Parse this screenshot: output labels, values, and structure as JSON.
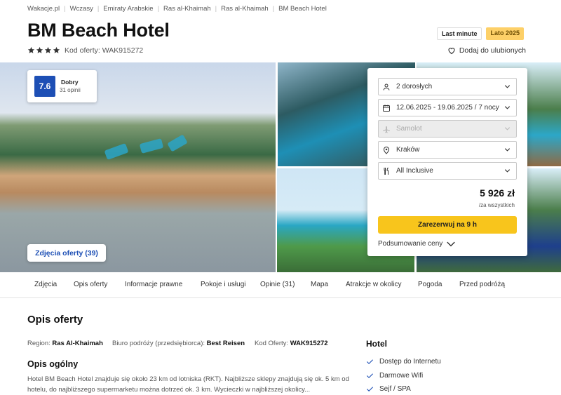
{
  "breadcrumbs": [
    "Wakacje.pl",
    "Wczasy",
    "Emiraty Arabskie",
    "Ras al-Khaimah",
    "Ras al-Khaimah",
    "BM Beach Hotel"
  ],
  "hotel": {
    "name": "BM Beach Hotel",
    "stars": 4,
    "offer_code_label": "Kod oferty: WAK915272"
  },
  "badges": {
    "last_minute": "Last minute",
    "season": "Lato 2025"
  },
  "favorite_label": "Dodaj do ulubionych",
  "rating": {
    "score": "7.6",
    "label": "Dobry",
    "count": "31 opinii"
  },
  "photos_button": "Zdjęcia oferty (39)",
  "booking": {
    "travelers": "2 dorosłych",
    "dates": "12.06.2025 - 19.06.2025 / 7 nocy",
    "transport": "Samolot",
    "departure": "Kraków",
    "board": "All Inclusive",
    "price": "5 926 zł",
    "price_note": "/za wszystkich",
    "book_button": "Zarezerwuj na 9 h",
    "summary_link": "Podsumowanie ceny"
  },
  "tabs": [
    "Zdjęcia",
    "Opis oferty",
    "Informacje prawne",
    "Pokoje i usługi",
    "Opinie (31)",
    "Mapa",
    "Atrakcje w okolicy",
    "Pogoda",
    "Przed podróżą"
  ],
  "description": {
    "heading": "Opis oferty",
    "region_label": "Region:",
    "region_value": "Ras Al-Khaimah",
    "agency_label": "Biuro podróży (przedsiębiorca):",
    "agency_value": "Best Reisen",
    "code_label": "Kod Oferty:",
    "code_value": "WAK915272",
    "general_heading": "Opis ogólny",
    "general_text": "Hotel BM Beach Hotel znajduje się około 23 km od lotniska (RKT). Najbliższe sklepy znajdują się ok. 5 km od hotelu, do najbliższego supermarketu można dotrzeć ok. 3 km. Wycieczki w najbliższej okolicy..."
  },
  "amenities": {
    "heading": "Hotel",
    "items": [
      "Dostęp do Internetu",
      "Darmowe Wifi",
      "Sejf / SPA"
    ]
  },
  "colors": {
    "brand_blue": "#1d4fb5",
    "book_yellow": "#f8c51c",
    "season_badge": "#fdd068"
  }
}
